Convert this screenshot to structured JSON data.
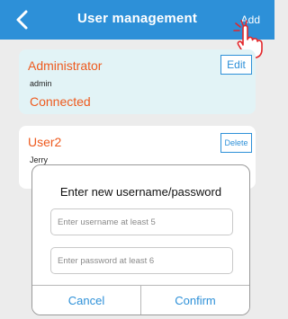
{
  "header": {
    "title": "User management",
    "add_label": "Add",
    "back_icon": "chevron-left-icon"
  },
  "users": [
    {
      "name": "Administrator",
      "login": "admin",
      "status": "Connected",
      "action_label": "Edit"
    },
    {
      "name": "User2",
      "login": "Jerry",
      "action_label": "Delete"
    }
  ],
  "dialog": {
    "title": "Enter new username/password",
    "username_placeholder": "Enter username at least 5",
    "password_placeholder": "Enter password at least 6",
    "cancel_label": "Cancel",
    "confirm_label": "Confirm"
  },
  "colors": {
    "header_bg": "#2d90d8",
    "accent": "#ee5a1e",
    "admin_card_bg": "#e2f3f6",
    "page_bg": "#ececec"
  }
}
